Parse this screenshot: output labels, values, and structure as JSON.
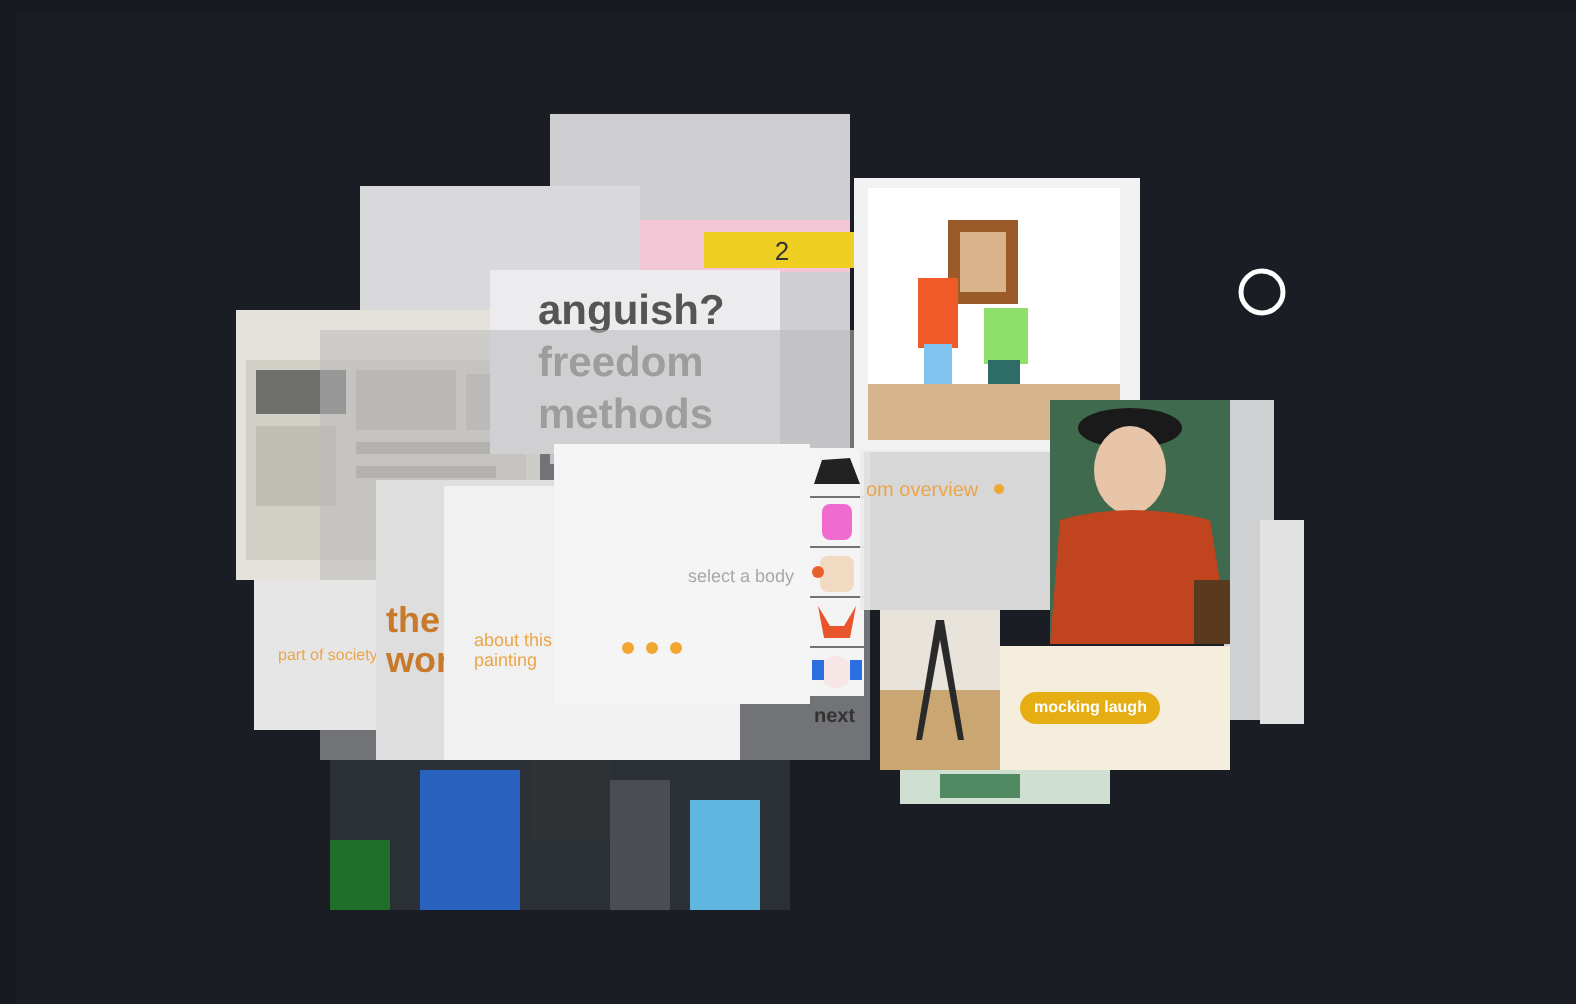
{
  "headline": {
    "lines": [
      "anguish?",
      "freedom",
      "methods"
    ]
  },
  "counter": {
    "text": "2"
  },
  "article": {
    "title_lines": [
      "the",
      "wor"
    ],
    "tag": "part of society",
    "link": "about this painting"
  },
  "body_picker": {
    "prompt": "select a body",
    "next": "next"
  },
  "overview": {
    "label": "om overview"
  },
  "emotion": {
    "label": "mocking laugh"
  }
}
